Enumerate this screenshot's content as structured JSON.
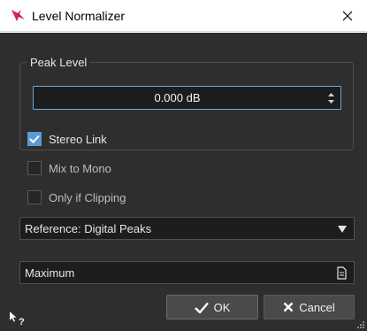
{
  "window": {
    "title": "Level Normalizer",
    "close_icon": "close-icon",
    "logo_icon": "wavelab-logo-icon",
    "accent_color": "#5a9bd5",
    "logo_color": "#c2185b"
  },
  "peak_level": {
    "group_title": "Peak Level",
    "value": "0.000 dB",
    "spin_icon": "spin-arrows-icon"
  },
  "options": {
    "stereo_link": {
      "label": "Stereo Link",
      "checked": true
    },
    "mix_to_mono": {
      "label": "Mix to Mono",
      "checked": false
    },
    "only_if_clipping": {
      "label": "Only if Clipping",
      "checked": false
    }
  },
  "reference": {
    "selected": "Reference: Digital Peaks",
    "arrow_icon": "dropdown-arrow-icon"
  },
  "preset": {
    "label": "Maximum",
    "icon": "preset-menu-icon"
  },
  "buttons": {
    "ok_label": "OK",
    "ok_icon": "checkmark-icon",
    "cancel_label": "Cancel",
    "cancel_icon": "x-icon"
  },
  "footer": {
    "help_icon": "context-help-icon",
    "resize_icon": "resize-grip-icon"
  }
}
